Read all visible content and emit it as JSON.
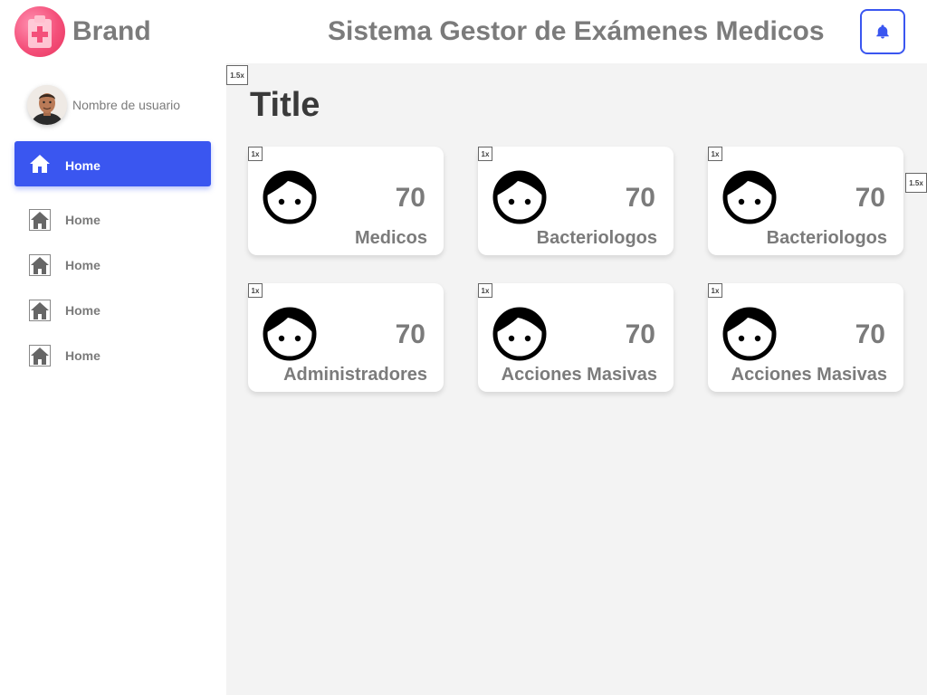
{
  "header": {
    "brand": "Brand",
    "title": "Sistema Gestor de Exámenes Medicos",
    "bell_icon": "bell-icon",
    "accent": "#3a56f0"
  },
  "sidebar": {
    "username": "Nombre de usuario",
    "items": [
      {
        "label": "Home",
        "icon": "home-icon",
        "active": true
      },
      {
        "label": "Home",
        "icon": "home-icon",
        "active": false
      },
      {
        "label": "Home",
        "icon": "home-icon",
        "active": false
      },
      {
        "label": "Home",
        "icon": "home-icon",
        "active": false
      },
      {
        "label": "Home",
        "icon": "home-icon",
        "active": false
      }
    ]
  },
  "main": {
    "title": "Title",
    "scale_tags": [
      "1.5x",
      "1.5x"
    ],
    "cards": [
      {
        "count": "70",
        "label": "Medicos",
        "tag": "1x",
        "icon": "face-icon"
      },
      {
        "count": "70",
        "label": "Bacteriologos",
        "tag": "1x",
        "icon": "face-icon"
      },
      {
        "count": "70",
        "label": "Bacteriologos",
        "tag": "1x",
        "icon": "face-icon"
      },
      {
        "count": "70",
        "label": "Administradores",
        "tag": "1x",
        "icon": "face-icon"
      },
      {
        "count": "70",
        "label": "Acciones Masivas",
        "tag": "1x",
        "icon": "face-icon"
      },
      {
        "count": "70",
        "label": "Acciones Masivas",
        "tag": "1x",
        "icon": "face-icon"
      }
    ]
  }
}
